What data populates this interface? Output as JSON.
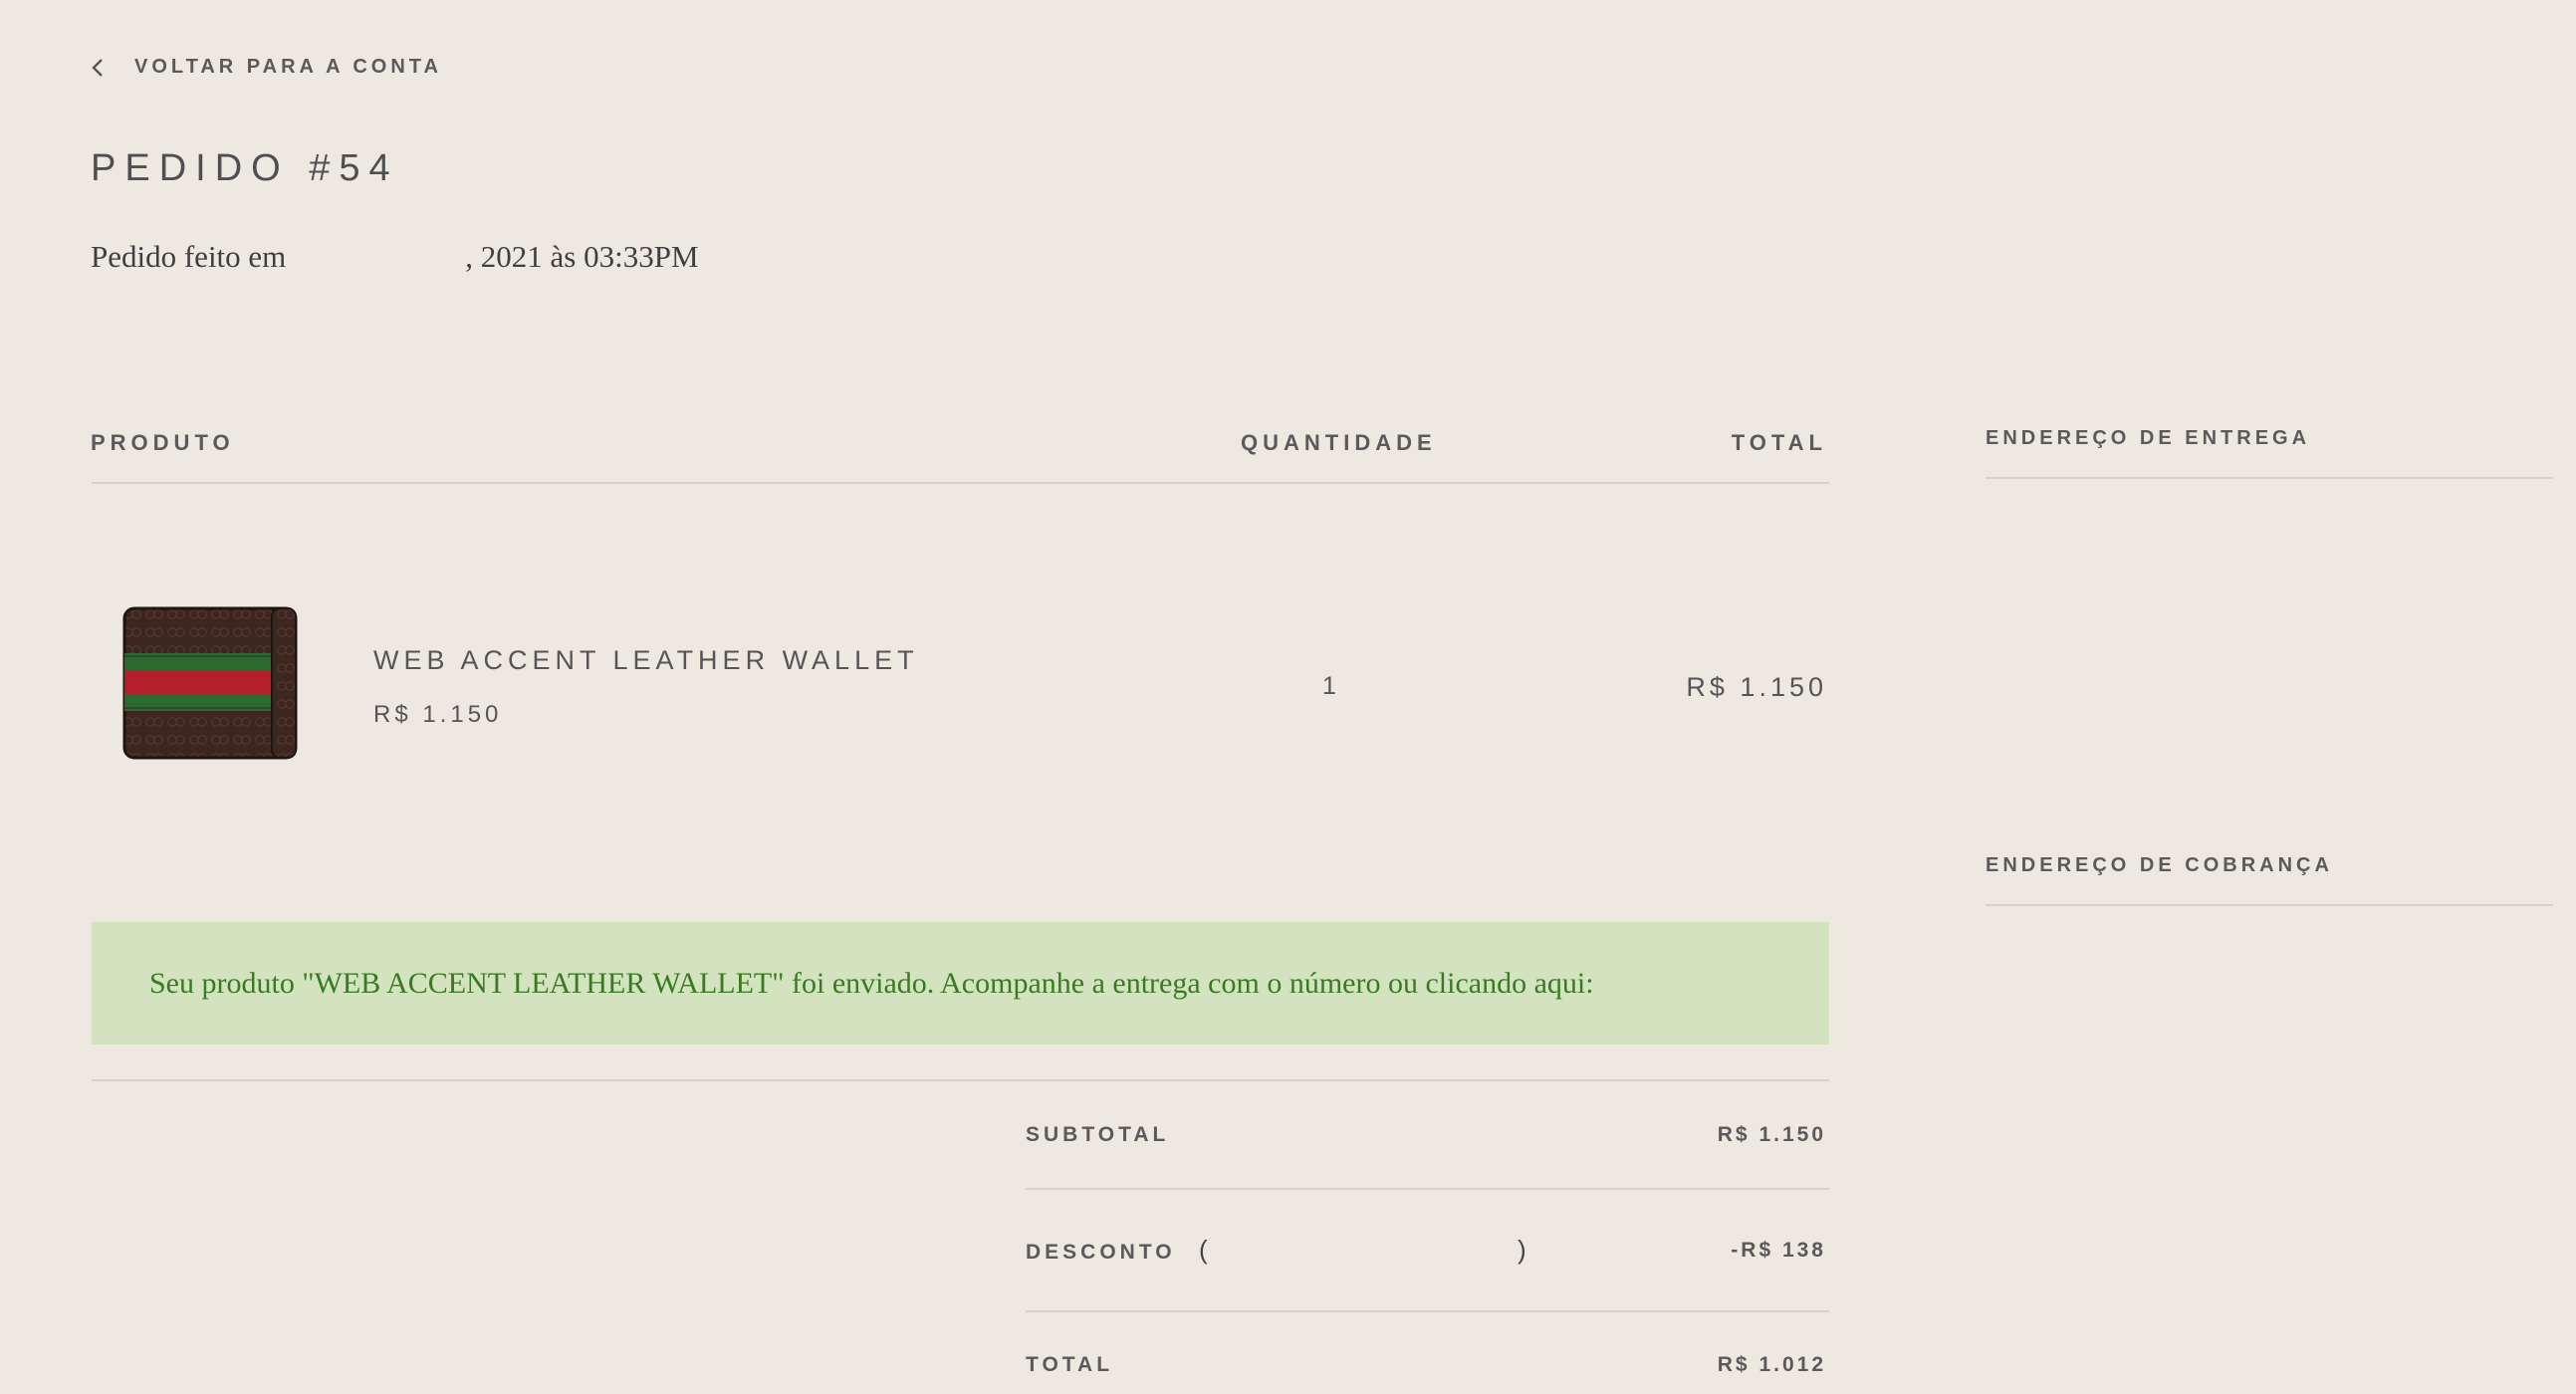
{
  "nav": {
    "back_label": "VOLTAR PARA A CONTA"
  },
  "order": {
    "title": "PEDIDO #54",
    "date_prefix": "Pedido feito em",
    "date_suffix": ", 2021 às 03:33PM"
  },
  "table": {
    "headers": {
      "product": "PRODUTO",
      "quantity": "QUANTIDADE",
      "total": "TOTAL"
    },
    "items": [
      {
        "name": "WEB ACCENT LEATHER WALLET",
        "price": "R$ 1.150",
        "quantity": "1",
        "total": "R$ 1.150",
        "image_icon": "wallet-thumbnail"
      }
    ]
  },
  "notice": {
    "text": "Seu produto \"WEB ACCENT LEATHER WALLET\" foi enviado. Acompanhe a entrega com o número ou clicando aqui:"
  },
  "summary": {
    "subtotal_label": "SUBTOTAL",
    "subtotal_value": "R$ 1.150",
    "discount_label": "DESCONTO",
    "discount_open": "(",
    "discount_close": ")",
    "discount_value": "-R$ 138",
    "total_label": "TOTAL",
    "total_value": "R$ 1.012"
  },
  "sidebar": {
    "shipping_heading": "ENDEREÇO DE ENTREGA",
    "billing_heading": "ENDEREÇO DE COBRANÇA"
  },
  "colors": {
    "background": "#ede8e0",
    "notice_bg": "#d3e3c0",
    "notice_text": "#3a7a22",
    "divider": "#d6d1c9"
  }
}
